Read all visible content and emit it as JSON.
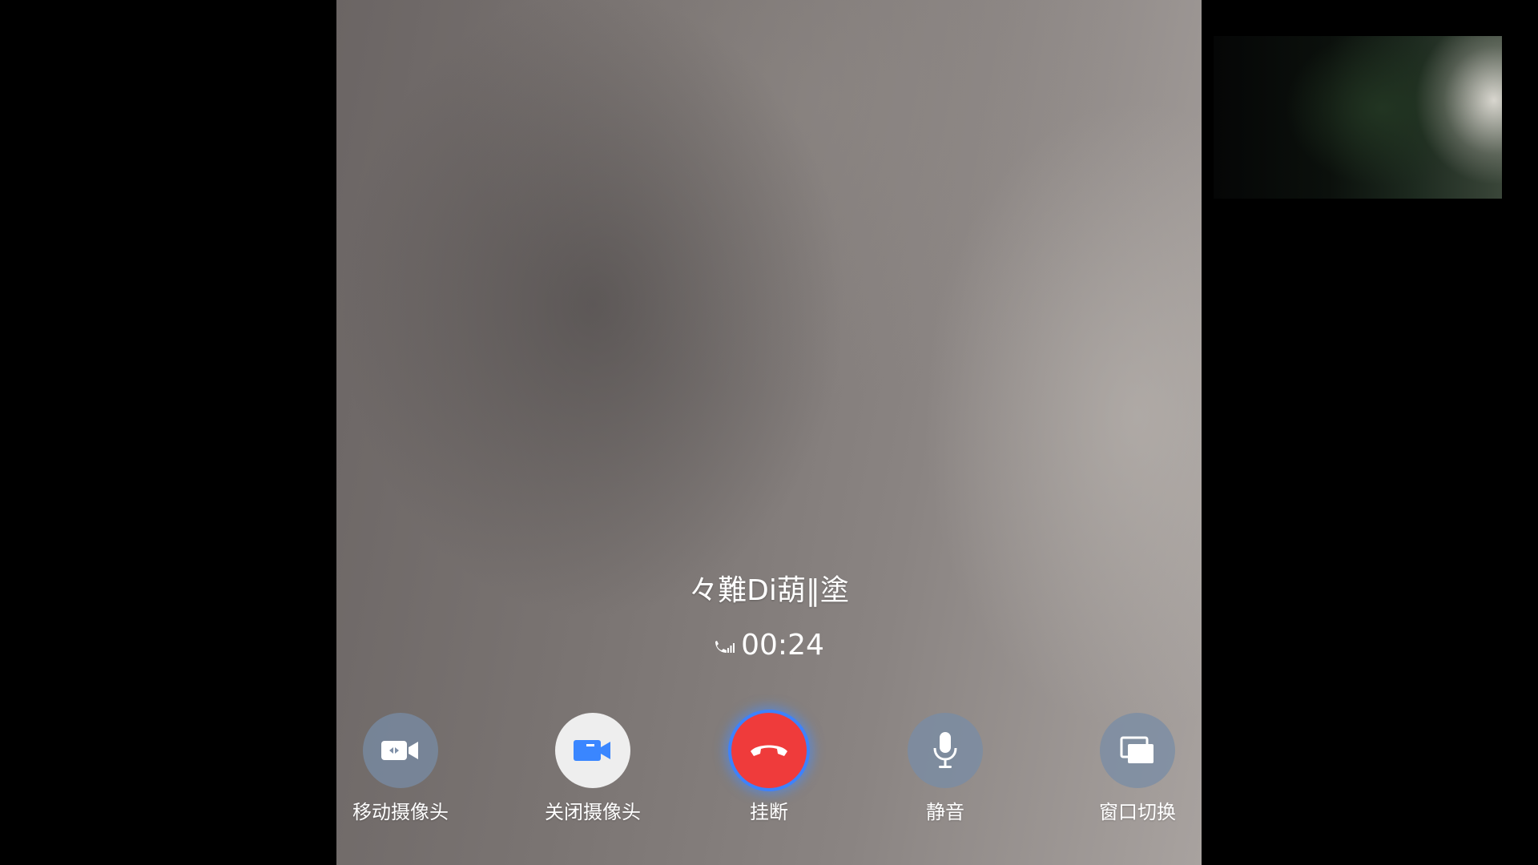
{
  "call": {
    "caller_name": "々難Di葫‖塗",
    "timer": "00:24"
  },
  "controls": [
    {
      "label": "移动摄像头",
      "icon": "camera-switch-icon"
    },
    {
      "label": "关闭摄像头",
      "icon": "video-camera-icon"
    },
    {
      "label": "挂断",
      "icon": "hang-up-icon"
    },
    {
      "label": "静音",
      "icon": "microphone-icon"
    },
    {
      "label": "窗口切换",
      "icon": "window-switch-icon"
    }
  ],
  "colors": {
    "hangup_red": "#ef3b3b",
    "accent_blue": "#3a86ff",
    "button_gray": "#7f90a8"
  }
}
